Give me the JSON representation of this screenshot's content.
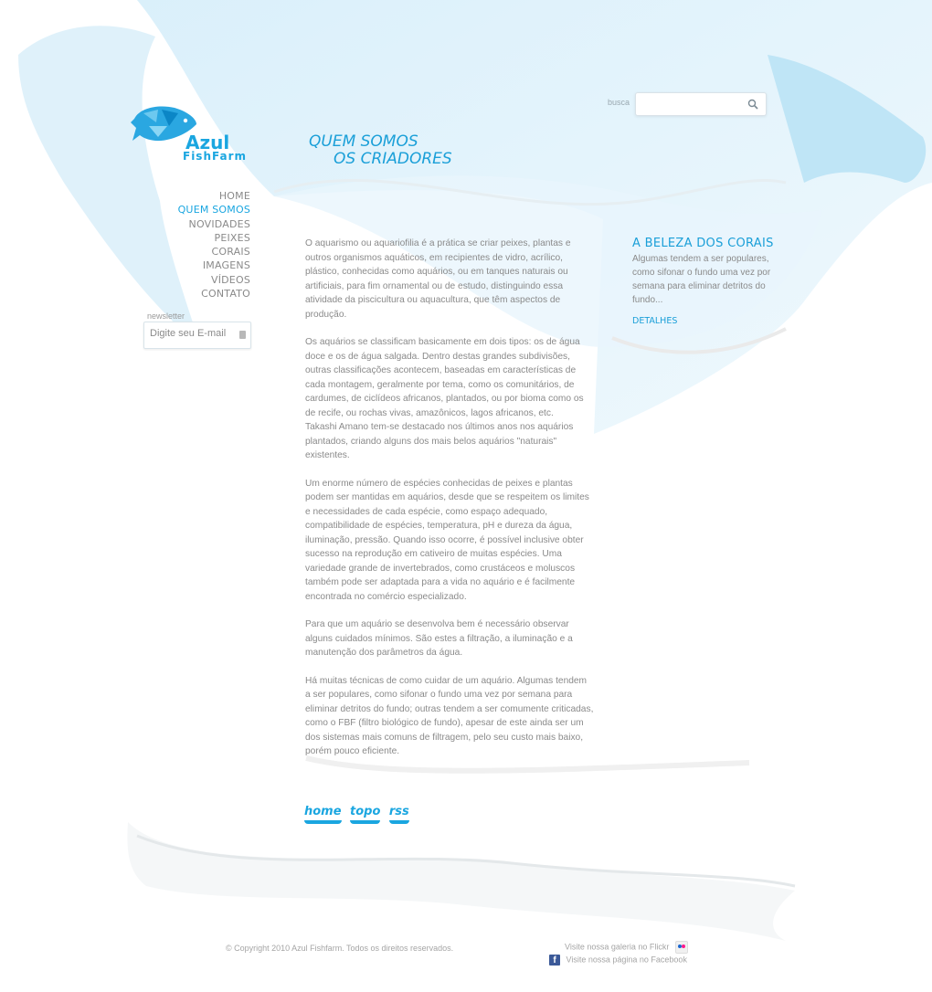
{
  "brand": {
    "name": "Azul",
    "sub": "FishFarm"
  },
  "nav": {
    "items": [
      {
        "label": "HOME"
      },
      {
        "label": "QUEM SOMOS",
        "active": true
      },
      {
        "label": "NOVIDADES"
      },
      {
        "label": "PEIXES"
      },
      {
        "label": "CORAIS"
      },
      {
        "label": "IMAGENS"
      },
      {
        "label": "VÍDEOS"
      },
      {
        "label": "CONTATO"
      }
    ]
  },
  "newsletter": {
    "label": "newsletter",
    "placeholder": "Digite seu E-mail"
  },
  "search": {
    "label": "busca",
    "value": ""
  },
  "page": {
    "title_line1": "QUEM SOMOS",
    "title_line2": "OS CRIADORES"
  },
  "content": {
    "p1": "O aquarismo ou aquariofilia é a prática se criar peixes, plantas e outros organismos aquáticos, em recipientes de vidro, acrílico, plástico, conhecidas como aquários, ou em tanques naturais ou artificiais, para fim ornamental ou de estudo, distinguindo essa atividade da piscicultura ou aquacultura, que têm aspectos de produção.",
    "p2a": "Os aquários se classificam basicamente em dois tipos: os de água doce e os de água salgada. Dentro destas grandes subdivisões, outras classificações acontecem, baseadas em características de cada montagem, geralmente por tema, como os comunitários, de cardumes, de ciclídeos africanos, plantados, ou por bioma como os de recife, ou rochas vivas, amazônicos, lagos africanos, etc.",
    "p2b": "Takashi Amano tem-se destacado nos últimos anos nos aquários plantados, criando alguns dos mais belos aquários \"naturais\" existentes.",
    "p3": "Um enorme número de espécies conhecidas de peixes e plantas podem ser mantidas em aquários, desde que se respeitem os limites e necessidades de cada espécie, como espaço adequado, compatibilidade de espécies, temperatura, pH e dureza da água, iluminação, pressão. Quando isso ocorre, é possível inclusive obter sucesso na reprodução em cativeiro de muitas espécies. Uma variedade grande de invertebrados, como crustáceos e moluscos também pode ser adaptada para a vida no aquário e é facilmente encontrada no comércio especializado.",
    "p4": "Para que um aquário se desenvolva bem é necessário observar alguns cuidados mínimos. São estes a filtração, a iluminação e a manutenção dos parâmetros da água.",
    "p5": "Há muitas técnicas de como cuidar de um aquário. Algumas tendem a ser populares, como sifonar o fundo uma vez por semana para eliminar detritos do fundo; outras tendem a ser comumente criticadas, como o FBF (filtro biológico de fundo), apesar de este ainda ser um dos sistemas mais comuns de filtragem, pelo seu custo mais baixo, porém pouco eficiente."
  },
  "sidebar": {
    "title": "A BELEZA DOS CORAIS",
    "text": "Algumas tendem a ser populares, como sifonar o fundo uma vez por semana para eliminar detritos do fundo...",
    "link": "DETALHES"
  },
  "footer": {
    "links": [
      "home",
      "topo",
      "rss"
    ],
    "copyright": "© Copyright 2010 Azul Fishfarm. Todos os direitos reservados.",
    "flickr": "Visite nossa galeria no Flickr",
    "facebook": "Visite nossa página no Facebook"
  },
  "colors": {
    "accent": "#1aa6e0",
    "text": "#8a8a8a"
  }
}
